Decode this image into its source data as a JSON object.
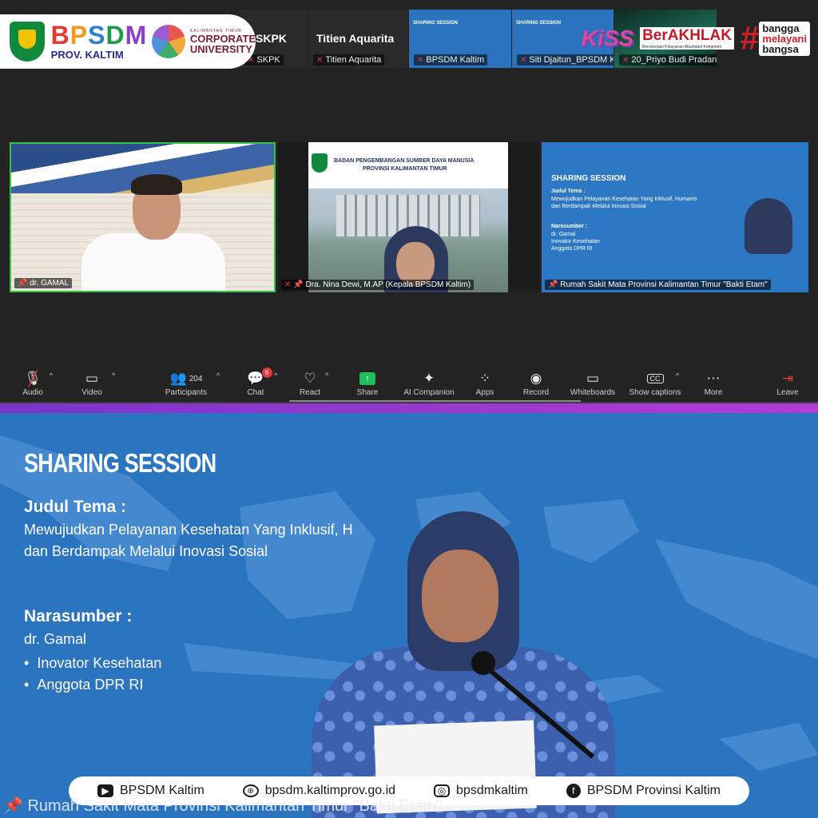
{
  "logo": {
    "main": [
      "B",
      "P",
      "S",
      "D",
      "M"
    ],
    "sub": "PROV. KALTIM",
    "corp_small": "KALIMANTAN TIMUR",
    "corp_big1": "CORPORATE",
    "corp_big2": "UNIVERSITY"
  },
  "brand": {
    "kiss": "KiSS",
    "berakhlak": "BerAKHLAK",
    "berakhlak_sub": "Berorientasi Pelayanan Akuntabel Kompeten",
    "hashtag": "#",
    "bangga": [
      "bangga",
      "melayani",
      "bangsa"
    ]
  },
  "strip": [
    {
      "name": "SKPK",
      "big": "SKPK"
    },
    {
      "name": "Titien Aquarita",
      "big": "Titien Aquarita"
    },
    {
      "name": "BPSDM Kaltim",
      "big": "SHARING SESSION"
    },
    {
      "name": "Siti Djaitun_BPSDM Kaltim",
      "big": "SHARING SESSION"
    },
    {
      "name": "20_Priyo Budi Pradana",
      "big": ""
    }
  ],
  "tiles": {
    "gamal": {
      "name": "dr. GAMAL"
    },
    "nina": {
      "name": "Dra. Nina Dewi, M.AP (Kepala BPSDM Kaltim)",
      "head1": "BADAN PENGEMBANGAN SUMBER DAYA MANUSIA",
      "head2": "PROVINSI KALIMANTAN TIMUR"
    },
    "rs": {
      "name": "Rumah Sakit Mata Provinsi Kalimantan Timur \"Bakti Etam\"",
      "title": "SHARING SESSION",
      "judul": "Judul Tema :",
      "tema1": "Mewujudkan Pelayanan Kesehatan Yang Inklusif, Humanis",
      "tema2": "dan Berdampak Melalui Inovasi Sosial",
      "nara": "Narasumber :",
      "n1": "dr. Gamal",
      "n2": "Inovator Kesehatan",
      "n3": "Anggota DPR RI"
    }
  },
  "toolbar": {
    "audio": "Audio",
    "video": "Video",
    "participants": "Participants",
    "participants_count": "204",
    "chat": "Chat",
    "chat_badge": "6",
    "react": "React",
    "share": "Share",
    "ai": "AI Companion",
    "apps": "Apps",
    "record": "Record",
    "whiteboards": "Whiteboards",
    "captions": "Show captions",
    "more": "More",
    "leave": "Leave"
  },
  "slide": {
    "title": "SHARING SESSION",
    "judul": "Judul Tema :",
    "tema1": "Mewujudkan Pelayanan Kesehatan Yang Inklusif, H",
    "tema2": "dan Berdampak Melalui Inovasi Sosial",
    "nara": "Narasumber :",
    "n1": "dr. Gamal",
    "b1": "Inovator Kesehatan",
    "b2": "Anggota DPR RI"
  },
  "footer": {
    "yt": "BPSDM Kaltim",
    "web": "bpsdm.kaltimprov.go.id",
    "ig": "bpsdmkaltim",
    "fb": "BPSDM Provinsi Kaltim"
  },
  "bottom_name": "Rumah Sakit Mata Provinsi Kalimantan Timur \"Bakti Etam\""
}
